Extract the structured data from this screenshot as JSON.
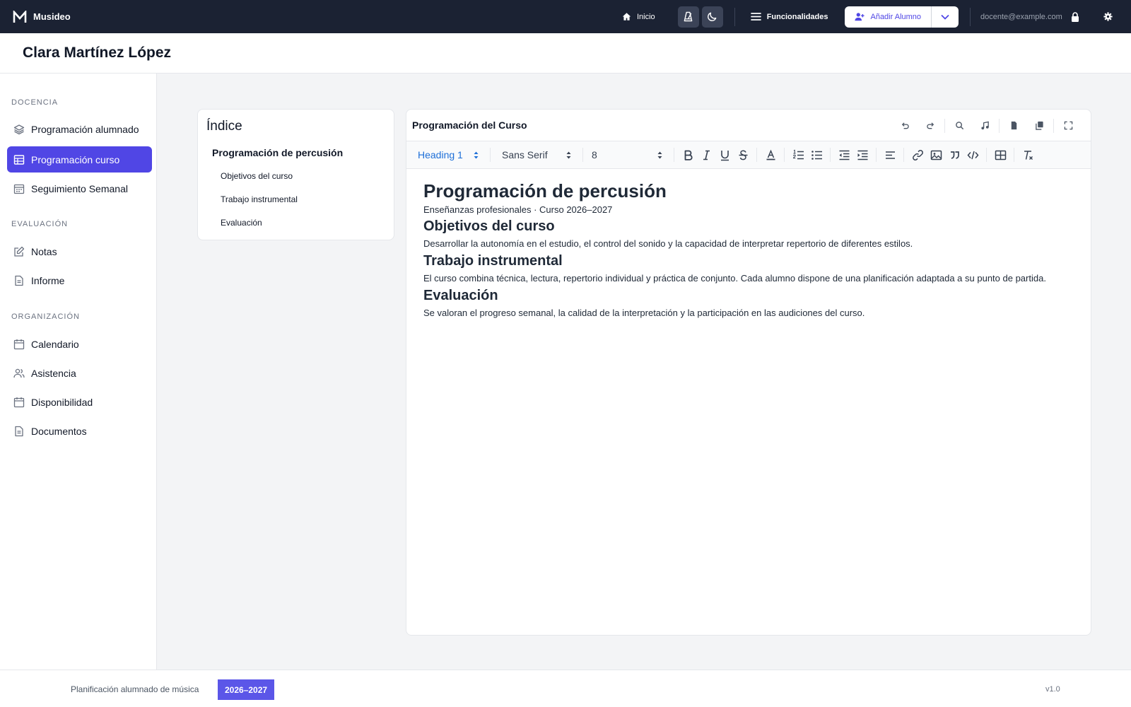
{
  "app": {
    "name": "Musideo",
    "brand_color": "#1b2233",
    "accent_color": "#5046e5"
  },
  "topbar": {
    "home_label": "Inicio",
    "features_label": "Funcionalidades",
    "add_student_label": "Añadir Alumno",
    "user_email": "docente@example.com",
    "icons": [
      "home-icon",
      "metronome-icon",
      "moon-icon",
      "menu-icon",
      "user-plus-icon",
      "chevron-down-icon",
      "lock-icon",
      "gear-icon"
    ]
  },
  "header": {
    "title": "Clara Martínez López"
  },
  "sidebar": {
    "sections": [
      {
        "title": "DOCENCIA",
        "items": [
          {
            "label": "Programación alumnado",
            "icon": "layers-icon"
          },
          {
            "label": "Programación curso",
            "icon": "table-icon",
            "active": true
          },
          {
            "label": "Seguimiento Semanal",
            "icon": "calendar-week-icon"
          }
        ]
      },
      {
        "title": "EVALUACIÓN",
        "items": [
          {
            "label": "Notas",
            "icon": "edit-icon"
          },
          {
            "label": "Informe",
            "icon": "document-icon"
          }
        ]
      },
      {
        "title": "ORGANIZACIÓN",
        "items": [
          {
            "label": "Calendario",
            "icon": "calendar-icon"
          },
          {
            "label": "Asistencia",
            "icon": "users-icon"
          },
          {
            "label": "Disponibilidad",
            "icon": "calendar-icon"
          },
          {
            "label": "Documentos",
            "icon": "document-icon"
          }
        ]
      }
    ]
  },
  "index": {
    "title": "Índice",
    "heading": "Programación de percusión",
    "items": [
      "Objetivos del curso",
      "Trabajo instrumental",
      "Evaluación"
    ]
  },
  "editor": {
    "title": "Programación del Curso",
    "toolbar": {
      "heading_select": "Heading 1",
      "font_select": "Sans Serif",
      "size_select": "8"
    },
    "document": {
      "h1": "Programación de percusión",
      "subtitle": "Enseñanzas profesionales · Curso 2026–2027",
      "sections": [
        {
          "heading": "Objetivos del curso",
          "text": "Desarrollar la autonomía en el estudio, el control del sonido y la capacidad de interpretar repertorio de diferentes estilos."
        },
        {
          "heading": "Trabajo instrumental",
          "text": "El curso combina técnica, lectura, repertorio individual y práctica de conjunto. Cada alumno dispone de una planificación adaptada a su punto de partida."
        },
        {
          "heading": "Evaluación",
          "text": "Se valoran el progreso semanal, la calidad de la interpretación y la participación en las audiciones del curso."
        }
      ]
    }
  },
  "footer": {
    "text": "Planificación alumnado de música",
    "badge": "2026–2027",
    "version": "v1.0"
  }
}
